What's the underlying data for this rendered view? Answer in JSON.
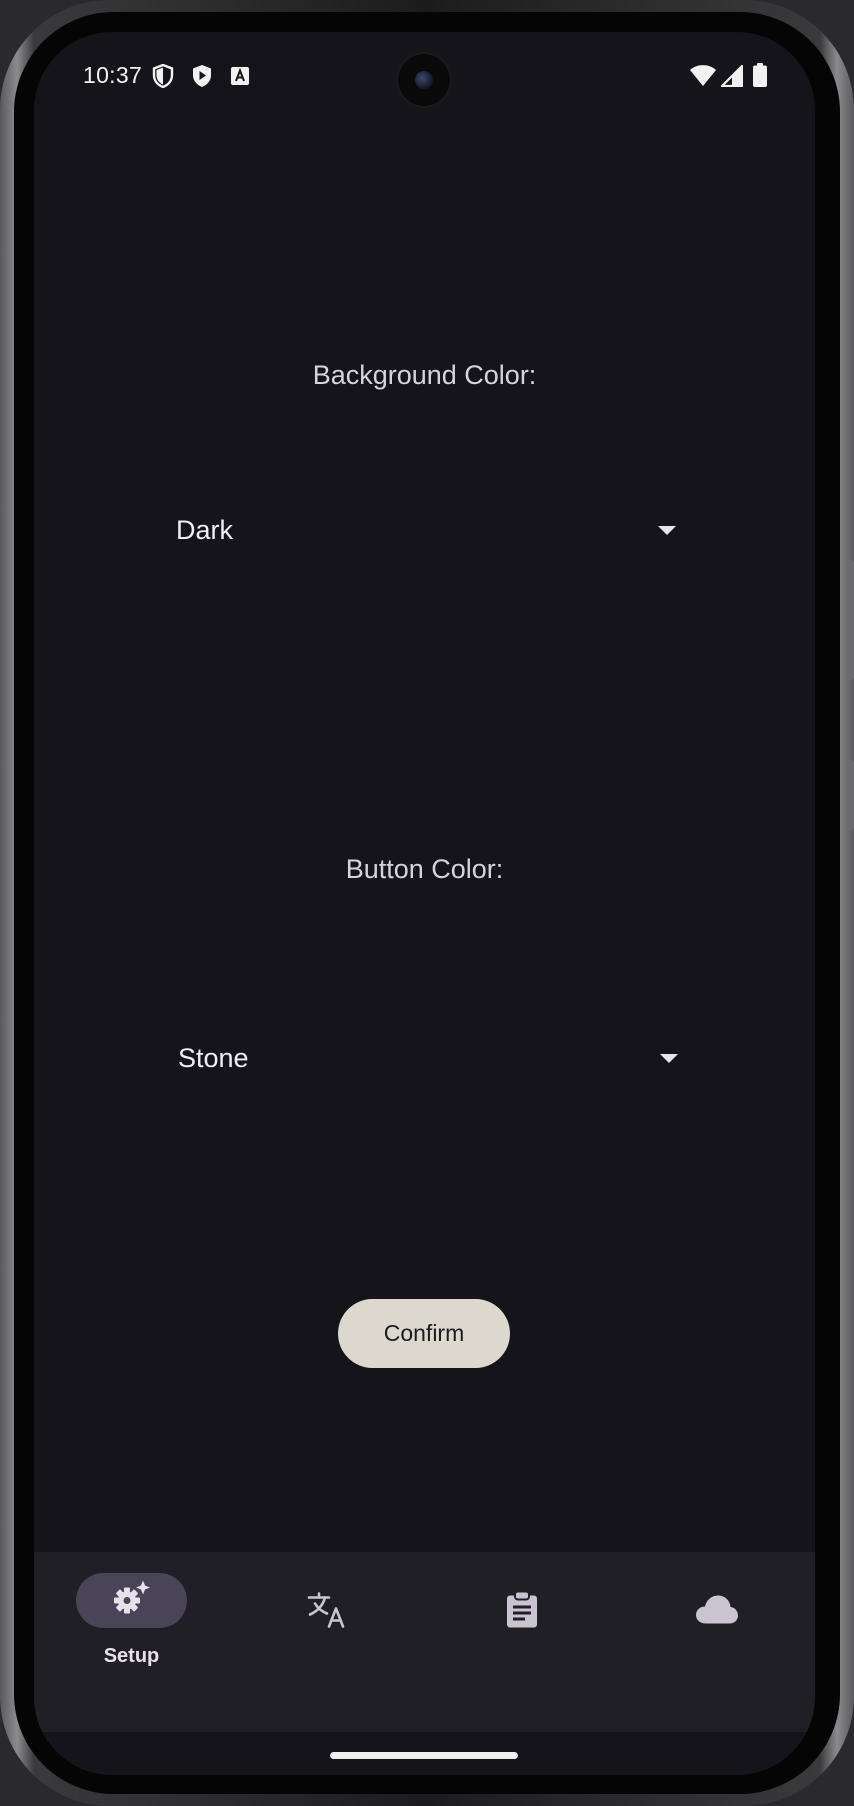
{
  "status_bar": {
    "time": "10:37"
  },
  "settings": {
    "background_label": "Background Color:",
    "background_value": "Dark",
    "button_label": "Button Color:",
    "button_value": "Stone",
    "confirm_label": "Confirm"
  },
  "bottom_nav": {
    "items": [
      {
        "label": "Setup",
        "icon": "settings-sparkle-icon",
        "selected": true
      },
      {
        "label": "",
        "icon": "translate-icon",
        "selected": false
      },
      {
        "label": "",
        "icon": "clipboard-icon",
        "selected": false
      },
      {
        "label": "",
        "icon": "cloud-icon",
        "selected": false
      }
    ]
  },
  "colors": {
    "screen_bg": "#16141b",
    "nav_bg": "#211f26",
    "selected_pill": "#4a4458",
    "confirm_button": "#dcd8cd"
  }
}
